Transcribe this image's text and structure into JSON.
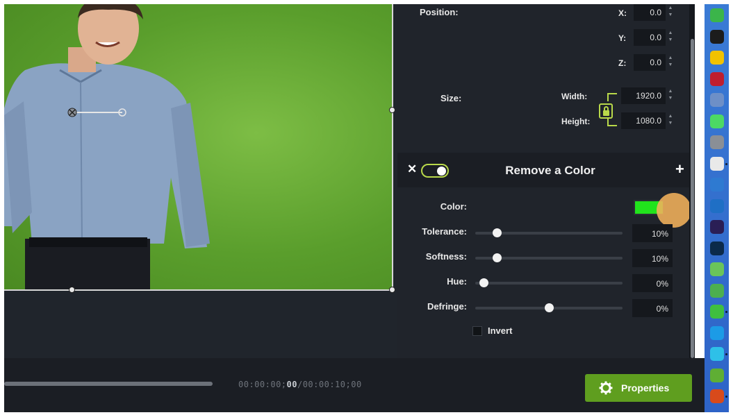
{
  "position": {
    "label": "Position:",
    "x": {
      "axis": "X:",
      "value": "0.0"
    },
    "y": {
      "axis": "Y:",
      "value": "0.0"
    },
    "z": {
      "axis": "Z:",
      "value": "0.0"
    }
  },
  "size": {
    "label": "Size:",
    "width": {
      "label": "Width:",
      "value": "1920.0"
    },
    "height": {
      "label": "Height:",
      "value": "1080.0"
    }
  },
  "effect": {
    "title": "Remove a Color",
    "close": "✕",
    "add": "+",
    "enabled": true,
    "color_label": "Color:",
    "color_value": "#21e31c",
    "sliders": [
      {
        "label": "Tolerance:",
        "value": "10%",
        "fraction": 0.1
      },
      {
        "label": "Softness:",
        "value": "10%",
        "fraction": 0.1
      },
      {
        "label": "Hue:",
        "value": "0%",
        "fraction": 0.0
      },
      {
        "label": "Defringe:",
        "value": "0%",
        "fraction": 0.5
      }
    ],
    "invert_label": "Invert",
    "invert_checked": false
  },
  "playback": {
    "time_prefix": "00:00:00;",
    "time_frame": "00",
    "time_total": "/00:00:10;00",
    "progress": 1.0
  },
  "properties_button": {
    "label": "Properties",
    "icon": "gear-icon"
  },
  "dock": [
    {
      "icon": "evernote-icon",
      "color": "#3bb54a"
    },
    {
      "icon": "text-editor-icon",
      "color": "#1c1c1c"
    },
    {
      "icon": "norton-icon",
      "color": "#f2c200"
    },
    {
      "icon": "filezilla-icon",
      "color": "#bf1e2e"
    },
    {
      "icon": "calculator-icon",
      "color": "#6d8fc7"
    },
    {
      "icon": "messages-icon",
      "color": "#4cd964"
    },
    {
      "icon": "gear-app-icon",
      "color": "#8a8f96"
    },
    {
      "icon": "chrome-icon",
      "color": "#e9e9e9"
    },
    {
      "icon": "share-icon",
      "color": "#2e7ad1"
    },
    {
      "icon": "outlook-icon",
      "color": "#1f6fc5"
    },
    {
      "icon": "premiere-icon",
      "color": "#2a1e55"
    },
    {
      "icon": "photoshop-icon",
      "color": "#0b2a4a"
    },
    {
      "icon": "android-icon",
      "color": "#6ac45a"
    },
    {
      "icon": "camtasia-icon",
      "color": "#4caf50"
    },
    {
      "icon": "screen-icon",
      "color": "#3fbf3f"
    },
    {
      "icon": "window-icon",
      "color": "#1c9be6"
    },
    {
      "icon": "search-app-icon",
      "color": "#2ec0e8"
    },
    {
      "icon": "camtasia-green-icon",
      "color": "#5fae34"
    },
    {
      "icon": "chrome-canary-icon",
      "color": "#d84a1b"
    }
  ]
}
